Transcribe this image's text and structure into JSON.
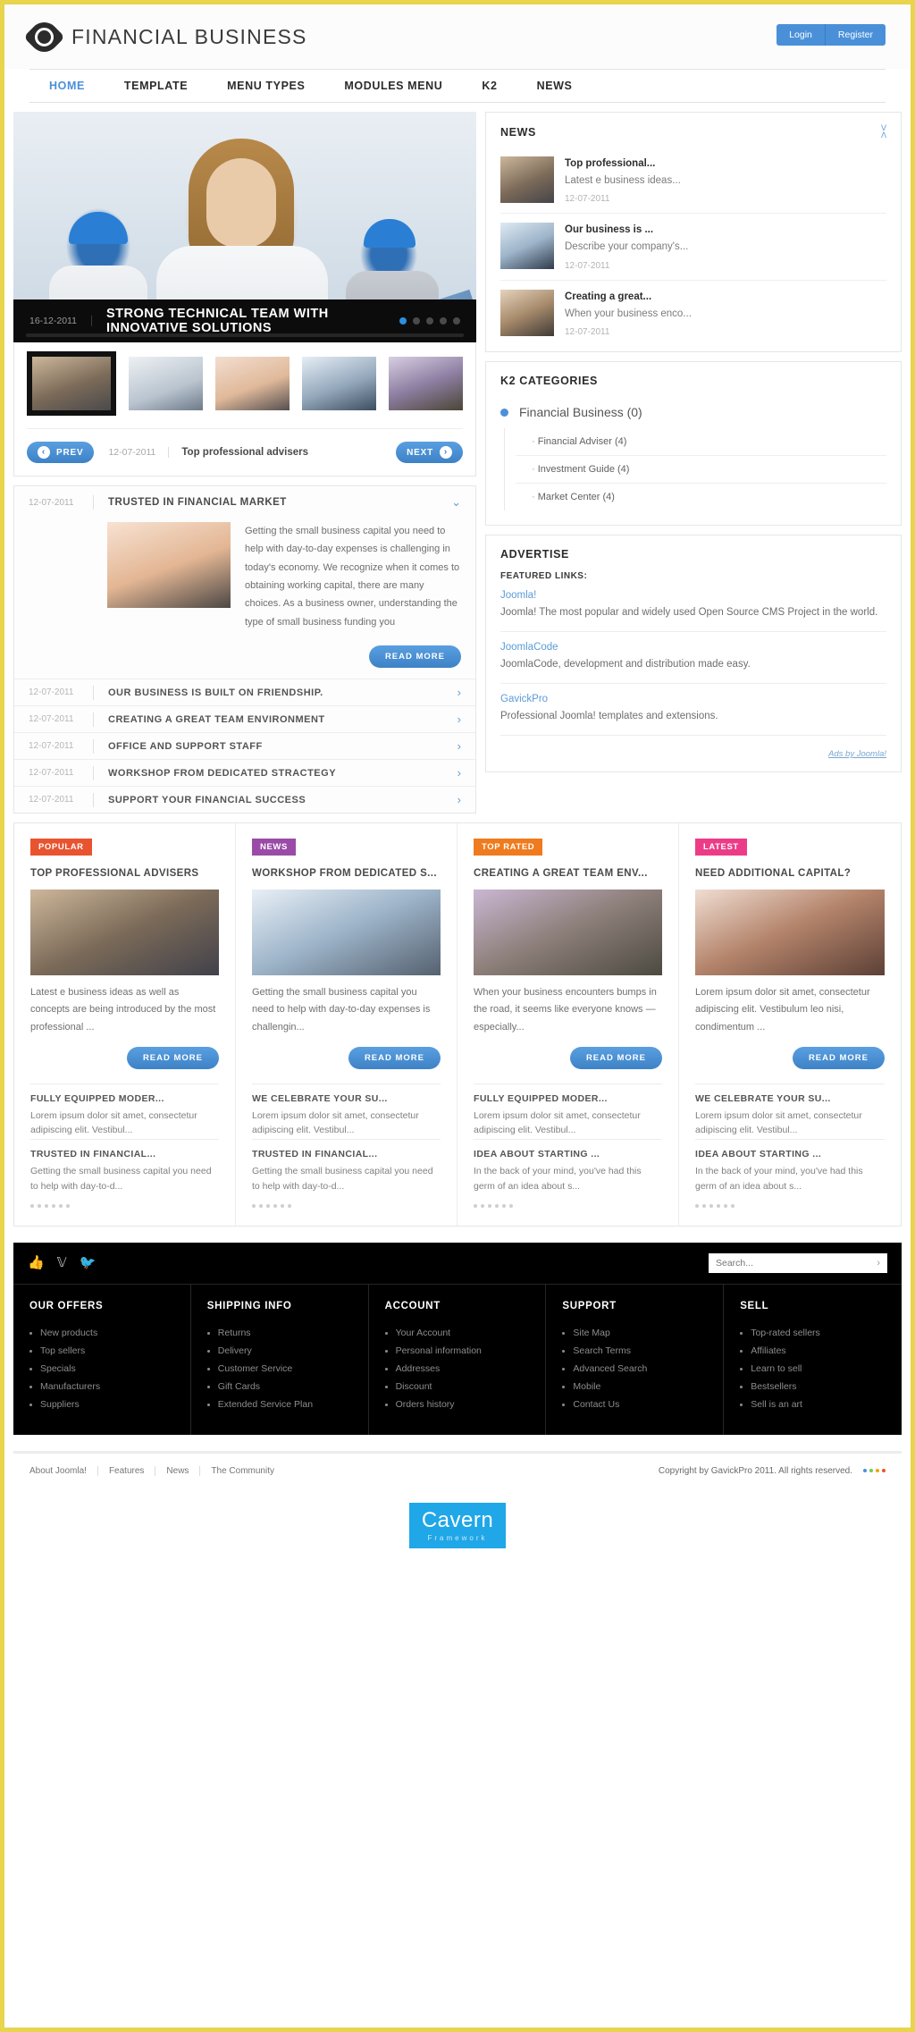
{
  "header": {
    "brand": "FINANCIAL BUSINESS",
    "login": "Login",
    "register": "Register"
  },
  "nav": {
    "items": [
      {
        "label": "HOME",
        "active": true
      },
      {
        "label": "TEMPLATE",
        "active": false
      },
      {
        "label": "MENU TYPES",
        "active": false
      },
      {
        "label": "MODULES MENU",
        "active": false
      },
      {
        "label": "K2",
        "active": false
      },
      {
        "label": "NEWS",
        "active": false
      }
    ]
  },
  "slider": {
    "date": "16-12-2011",
    "title": "STRONG TECHNICAL TEAM WITH INNOVATIVE SOLUTIONS",
    "dots": 5,
    "active_dot": 0,
    "prev_label": "PREV",
    "next_label": "NEXT",
    "nav_date": "12-07-2011",
    "nav_title": "Top professional advisers"
  },
  "accordion": {
    "open": {
      "date": "12-07-2011",
      "title": "TRUSTED IN FINANCIAL MARKET",
      "text": "Getting the small business capital you need to help with day-to-day expenses is challenging in today's economy. We recognize when it comes to obtaining working capital, there are many choices. As a business owner, understanding the type of small business funding you",
      "read_more": "READ MORE"
    },
    "rows": [
      {
        "date": "12-07-2011",
        "title": "OUR BUSINESS IS BUILT ON FRIENDSHIP."
      },
      {
        "date": "12-07-2011",
        "title": "CREATING A GREAT TEAM ENVIRONMENT"
      },
      {
        "date": "12-07-2011",
        "title": "OFFICE AND SUPPORT STAFF"
      },
      {
        "date": "12-07-2011",
        "title": "WORKSHOP FROM DEDICATED STRACTEGY"
      },
      {
        "date": "12-07-2011",
        "title": "SUPPORT YOUR FINANCIAL SUCCESS"
      }
    ]
  },
  "news_module": {
    "title": "NEWS",
    "items": [
      {
        "title": "Top professional...",
        "desc": "Latest e business ideas...",
        "date": "12-07-2011"
      },
      {
        "title": "Our business is ...",
        "desc": "Describe your company's...",
        "date": "12-07-2011"
      },
      {
        "title": "Creating a great...",
        "desc": "When your business enco...",
        "date": "12-07-2011"
      }
    ]
  },
  "k2_module": {
    "title": "K2 CATEGORIES",
    "parent": "Financial Business (0)",
    "children": [
      "Financial Adviser (4)",
      "Investment Guide (4)",
      "Market Center (4)"
    ]
  },
  "advertise": {
    "title": "ADVERTISE",
    "subtitle": "FEATURED LINKS:",
    "items": [
      {
        "link": "Joomla!",
        "desc": "Joomla! The most popular and widely used Open Source CMS Project in the world."
      },
      {
        "link": "JoomlaCode",
        "desc": "JoomlaCode, development and distribution made easy."
      },
      {
        "link": "GavickPro",
        "desc": "Professional Joomla! templates and extensions."
      }
    ],
    "footer": "Ads by Joomla!"
  },
  "quad": [
    {
      "badge": "POPULAR",
      "badge_color": "#e8542f",
      "title": "TOP PROFESSIONAL ADVISERS",
      "desc": "Latest e business ideas as well as concepts are being introduced by the most professional ...",
      "read_more": "READ MORE",
      "subs": [
        {
          "title": "FULLY EQUIPPED MODER...",
          "desc": "Lorem ipsum dolor sit amet, consectetur adipiscing elit. Vestibul..."
        },
        {
          "title": "TRUSTED IN FINANCIAL...",
          "desc": "Getting the small business capital you need to help with day-to-d..."
        }
      ]
    },
    {
      "badge": "NEWS",
      "badge_color": "#9a4ba8",
      "title": "WORKSHOP FROM DEDICATED S...",
      "desc": "Getting the small business capital you need to help with day-to-day expenses is challengin...",
      "read_more": "READ MORE",
      "subs": [
        {
          "title": "WE CELEBRATE YOUR SU...",
          "desc": "Lorem ipsum dolor sit amet, consectetur adipiscing elit. Vestibul..."
        },
        {
          "title": "TRUSTED IN FINANCIAL...",
          "desc": "Getting the small business capital you need to help with day-to-d..."
        }
      ]
    },
    {
      "badge": "TOP RATED",
      "badge_color": "#ef7b1e",
      "title": "CREATING A GREAT TEAM ENV...",
      "desc": "When your business encounters bumps in the road, it seems like everyone knows — especially...",
      "read_more": "READ MORE",
      "subs": [
        {
          "title": "FULLY EQUIPPED MODER...",
          "desc": "Lorem ipsum dolor sit amet, consectetur adipiscing elit. Vestibul..."
        },
        {
          "title": "IDEA ABOUT STARTING ...",
          "desc": "In the back of your mind, you've had this germ of an idea about s..."
        }
      ]
    },
    {
      "badge": "LATEST",
      "badge_color": "#ec3c87",
      "title": "NEED ADDITIONAL CAPITAL?",
      "desc": "Lorem ipsum dolor sit amet, consectetur adipiscing elit. Vestibulum leo nisi, condimentum ...",
      "read_more": "READ MORE",
      "subs": [
        {
          "title": "WE CELEBRATE YOUR SU...",
          "desc": "Lorem ipsum dolor sit amet, consectetur adipiscing elit. Vestibul..."
        },
        {
          "title": "IDEA ABOUT STARTING ...",
          "desc": "In the back of your mind, you've had this germ of an idea about s..."
        }
      ]
    }
  ],
  "footer": {
    "search_placeholder": "Search...",
    "columns": [
      {
        "heading": "OUR OFFERS",
        "items": [
          "New products",
          "Top sellers",
          "Specials",
          "Manufacturers",
          "Suppliers"
        ]
      },
      {
        "heading": "SHIPPING INFO",
        "items": [
          "Returns",
          "Delivery",
          "Customer Service",
          "Gift Cards",
          "Extended Service Plan"
        ]
      },
      {
        "heading": "ACCOUNT",
        "items": [
          "Your Account",
          "Personal information",
          "Addresses",
          "Discount",
          "Orders history"
        ]
      },
      {
        "heading": "SUPPORT",
        "items": [
          "Site Map",
          "Search Terms",
          "Advanced Search",
          "Mobile",
          "Contact Us"
        ]
      },
      {
        "heading": "SELL",
        "items": [
          "Top-rated sellers",
          "Affiliates",
          "Learn to sell",
          "Bestsellers",
          "Sell is an art"
        ]
      }
    ],
    "bottom_links": [
      "About Joomla!",
      "Features",
      "News",
      "The Community"
    ],
    "copyright": "Copyright by GavickPro 2011. All rights reserved.",
    "cavern_name": "Cavern",
    "cavern_sub": "Framework"
  }
}
